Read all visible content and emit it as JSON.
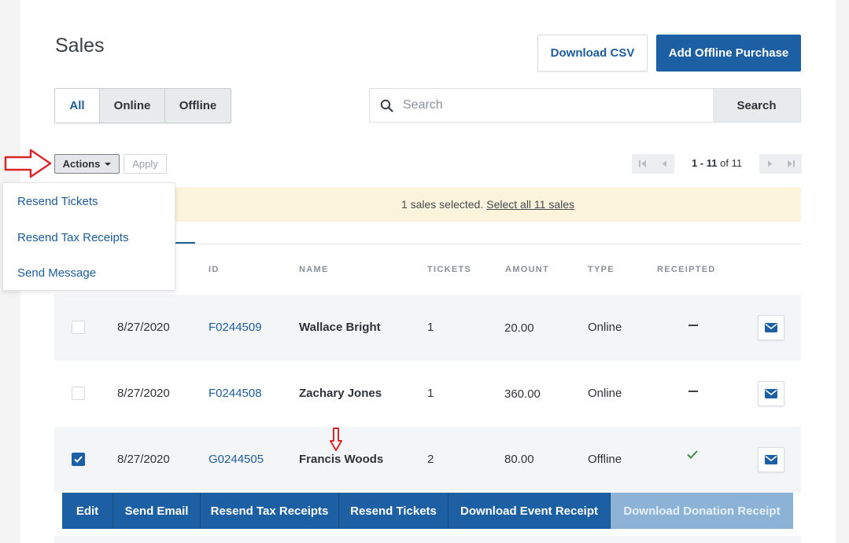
{
  "page": {
    "title": "Sales",
    "download_csv": "Download CSV",
    "add_offline": "Add Offline Purchase"
  },
  "filters": {
    "all": "All",
    "online": "Online",
    "offline": "Offline",
    "active": "All"
  },
  "search": {
    "placeholder": "Search",
    "button": "Search"
  },
  "toolbar": {
    "actions": "Actions",
    "apply": "Apply"
  },
  "pager": {
    "range": "1 - 11",
    "of": "of",
    "total": "11"
  },
  "banner": {
    "text": "1 sales selected.",
    "link": "Select all 11 sales"
  },
  "actions_menu": [
    "Resend Tickets",
    "Resend Tax Receipts",
    "Send Message"
  ],
  "table": {
    "headers": [
      "ID",
      "NAME",
      "TICKETS",
      "AMOUNT",
      "TYPE",
      "RECEIPTED"
    ],
    "rows": [
      {
        "checked": false,
        "date": "8/27/2020",
        "id": "F0244509",
        "name": "Wallace Bright",
        "tickets": "1",
        "amount": "20.00",
        "type": "Online",
        "receipted": false
      },
      {
        "checked": false,
        "date": "8/27/2020",
        "id": "F0244508",
        "name": "Zachary Jones",
        "tickets": "1",
        "amount": "360.00",
        "type": "Online",
        "receipted": false
      },
      {
        "checked": true,
        "date": "8/27/2020",
        "id": "G0244505",
        "name": "Francis Woods",
        "tickets": "2",
        "amount": "80.00",
        "type": "Offline",
        "receipted": true
      }
    ]
  },
  "row_actions": [
    "Edit",
    "Send Email",
    "Resend Tax Receipts",
    "Resend Tickets",
    "Download Event Receipt",
    "Download Donation Receipt"
  ],
  "colors": {
    "accent": "#1c5fa3",
    "banner": "#fcf3dc",
    "annotation_red": "#d9262c",
    "success": "#3a8a4b"
  }
}
